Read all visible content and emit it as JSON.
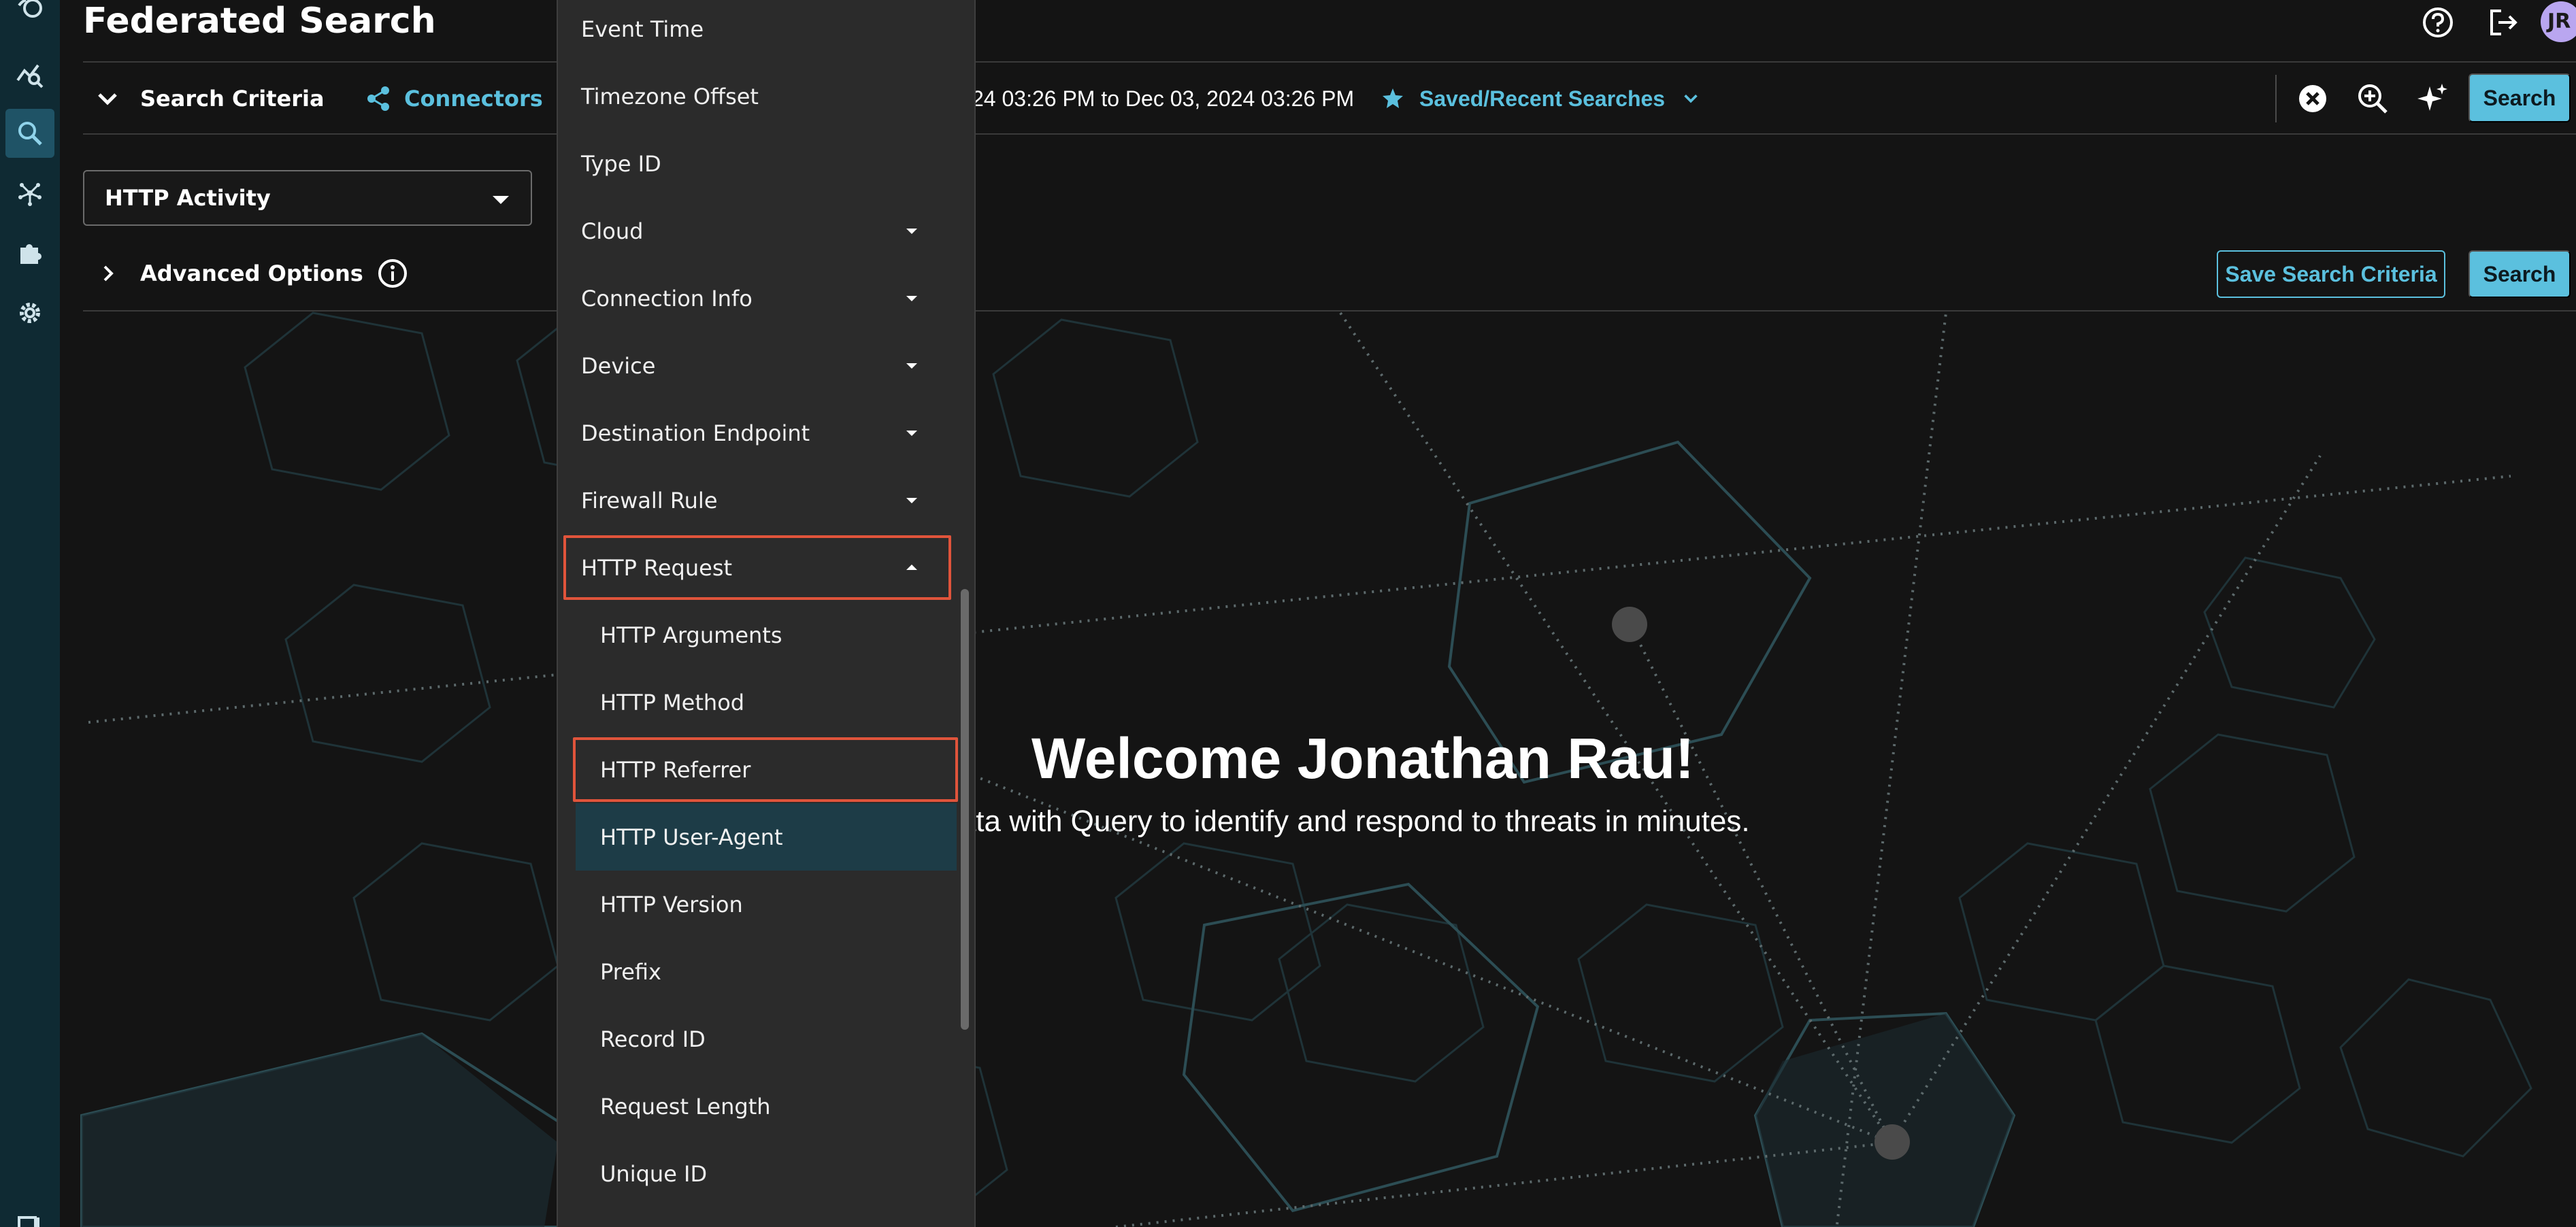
{
  "app": {
    "title": "Federated Search",
    "avatar_initials": "JR"
  },
  "rail": {
    "items": [
      {
        "name": "logo-icon"
      },
      {
        "name": "analytics-icon"
      },
      {
        "name": "search-icon",
        "active": true
      },
      {
        "name": "network-icon"
      },
      {
        "name": "extensions-icon"
      },
      {
        "name": "settings-icon"
      },
      {
        "name": "expand-icon"
      }
    ]
  },
  "criteria": {
    "toggle_label": "Search Criteria",
    "connectors_label": "Connectors",
    "date_range": "24 03:26 PM to Dec 03, 2024 03:26 PM",
    "saved_label": "Saved/Recent Searches",
    "search_label": "Search",
    "data_type_value": "HTTP Activity",
    "advanced_label": "Advanced Options",
    "save_criteria_label": "Save Search Criteria",
    "search_label_2": "Search"
  },
  "welcome": {
    "title": "Welcome Jonathan Rau!",
    "subtitle": "ur data with Query to identify and respond to threats in minutes."
  },
  "dropdown": {
    "items": [
      {
        "label": "Event Time",
        "level": 0
      },
      {
        "label": "Timezone Offset",
        "level": 0
      },
      {
        "label": "Type ID",
        "level": 0
      },
      {
        "label": "Cloud",
        "level": 0,
        "caret": "down"
      },
      {
        "label": "Connection Info",
        "level": 0,
        "caret": "down"
      },
      {
        "label": "Device",
        "level": 0,
        "caret": "down"
      },
      {
        "label": "Destination Endpoint",
        "level": 0,
        "caret": "down"
      },
      {
        "label": "Firewall Rule",
        "level": 0,
        "caret": "down"
      },
      {
        "label": "HTTP Request",
        "level": 0,
        "caret": "up",
        "highlighted": true
      },
      {
        "label": "HTTP Arguments",
        "level": 1
      },
      {
        "label": "HTTP Method",
        "level": 1
      },
      {
        "label": "HTTP Referrer",
        "level": 1,
        "highlighted": true
      },
      {
        "label": "HTTP User-Agent",
        "level": 1,
        "hovered": true
      },
      {
        "label": "HTTP Version",
        "level": 1
      },
      {
        "label": "Prefix",
        "level": 1
      },
      {
        "label": "Record ID",
        "level": 1
      },
      {
        "label": "Request Length",
        "level": 1
      },
      {
        "label": "Unique ID",
        "level": 1
      }
    ]
  },
  "colors": {
    "accent": "#5bc0de",
    "highlight_border": "#e0543b",
    "rail_bg": "#0f2a33",
    "dropdown_bg": "#2b2b2b",
    "hover_bg": "#1d3c47"
  }
}
